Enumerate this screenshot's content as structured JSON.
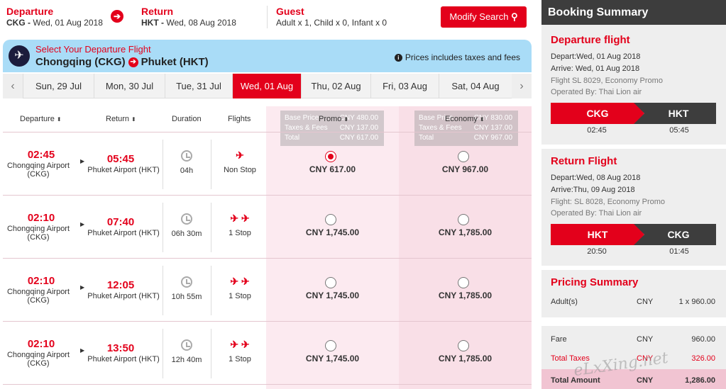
{
  "header": {
    "departure_label": "Departure",
    "departure_code": "CKG -",
    "departure_date": "Wed, 01 Aug 2018",
    "return_label": "Return",
    "return_code": "HKT -",
    "return_date": "Wed, 08 Aug 2018",
    "guest_label": "Guest",
    "guest_value": "Adult x 1, Child x 0, Infant x 0",
    "modify_label": "Modify Search",
    "arrow_glyph": "➔",
    "search_glyph": "⚲"
  },
  "banner": {
    "select_text": "Select Your Departure Flight",
    "origin": "Chongqing (CKG)",
    "destination": "Phuket (HKT)",
    "price_note": "Prices includes taxes and fees",
    "plane_glyph": "✈",
    "route_glyph": "➔",
    "info_glyph": "i"
  },
  "dates": {
    "prev_glyph": "‹",
    "next_glyph": "›",
    "tabs": [
      "Sun, 29 Jul",
      "Mon, 30 Jul",
      "Tue, 31 Jul",
      "Wed, 01 Aug",
      "Thu, 02 Aug",
      "Fri, 03 Aug",
      "Sat, 04 Aug"
    ],
    "active_index": 3
  },
  "columns": {
    "departure": "Departure",
    "return": "Return",
    "duration": "Duration",
    "flights": "Flights",
    "promo": "Promo",
    "economy": "Economy",
    "sort_glyph": "⬍"
  },
  "tooltips": {
    "promo": {
      "base_label": "Base Price",
      "base_value": "CNY 480.00",
      "tax_label": "Taxes & Fees",
      "tax_value": "CNY 137.00",
      "total_label": "Total",
      "total_value": "CNY 617.00"
    },
    "economy": {
      "base_label": "Base Price",
      "base_value": "CNY 830.00",
      "tax_label": "Taxes & Fees",
      "tax_value": "CNY 137.00",
      "total_label": "Total",
      "total_value": "CNY 967.00"
    }
  },
  "flights": [
    {
      "dep_time": "02:45",
      "dep_airport": "Chongqing Airport",
      "dep_code": "(CKG)",
      "arr_time": "05:45",
      "arr_airport": "Phuket Airport (HKT)",
      "duration": "04h",
      "planes": "✈",
      "stops": "Non Stop",
      "promo": "CNY 617.00",
      "economy": "CNY 967.00",
      "selected": "promo"
    },
    {
      "dep_time": "02:10",
      "dep_airport": "Chongqing Airport",
      "dep_code": "(CKG)",
      "arr_time": "07:40",
      "arr_airport": "Phuket Airport (HKT)",
      "duration": "06h 30m",
      "planes": "✈ ✈",
      "stops": "1 Stop",
      "promo": "CNY 1,745.00",
      "economy": "CNY 1,785.00",
      "selected": ""
    },
    {
      "dep_time": "02:10",
      "dep_airport": "Chongqing Airport",
      "dep_code": "(CKG)",
      "arr_time": "12:05",
      "arr_airport": "Phuket Airport (HKT)",
      "duration": "10h 55m",
      "planes": "✈ ✈",
      "stops": "1 Stop",
      "promo": "CNY 1,745.00",
      "economy": "CNY 1,785.00",
      "selected": ""
    },
    {
      "dep_time": "02:10",
      "dep_airport": "Chongqing Airport",
      "dep_code": "(CKG)",
      "arr_time": "13:50",
      "arr_airport": "Phuket Airport (HKT)",
      "duration": "12h 40m",
      "planes": "✈ ✈",
      "stops": "1 Stop",
      "promo": "CNY 1,745.00",
      "economy": "CNY 1,785.00",
      "selected": ""
    }
  ],
  "summary": {
    "title": "Booking Summary",
    "departure": {
      "heading": "Departure flight",
      "depart": "Depart:Wed, 01 Aug 2018",
      "arrive": "Arrive: Wed, 01 Aug 2018",
      "flight": "Flight SL 8029, Economy Promo",
      "operated": "Operated By: Thai Lion air",
      "from": "CKG",
      "to": "HKT",
      "from_time": "02:45",
      "to_time": "05:45"
    },
    "return": {
      "heading": "Return Flight",
      "depart": "Depart:Wed, 08 Aug 2018",
      "arrive": "Arrive:Thu, 09 Aug 2018",
      "flight": "Flight: SL 8028, Economy Promo",
      "operated": "Operated By: Thai Lion air",
      "from": "HKT",
      "to": "CKG",
      "from_time": "20:50",
      "to_time": "01:45"
    },
    "pricing": {
      "heading": "Pricing Summary",
      "adults_label": "Adult(s)",
      "adults_cur": "CNY",
      "adults_value": "1 x 960.00",
      "fare_label": "Fare",
      "fare_cur": "CNY",
      "fare_value": "960.00",
      "tax_label": "Total Taxes",
      "tax_cur": "CNY",
      "tax_value": "326.00",
      "total_label": "Total Amount",
      "total_cur": "CNY",
      "total_value": "1,286.00"
    },
    "watermark": "eLxXing.net"
  }
}
